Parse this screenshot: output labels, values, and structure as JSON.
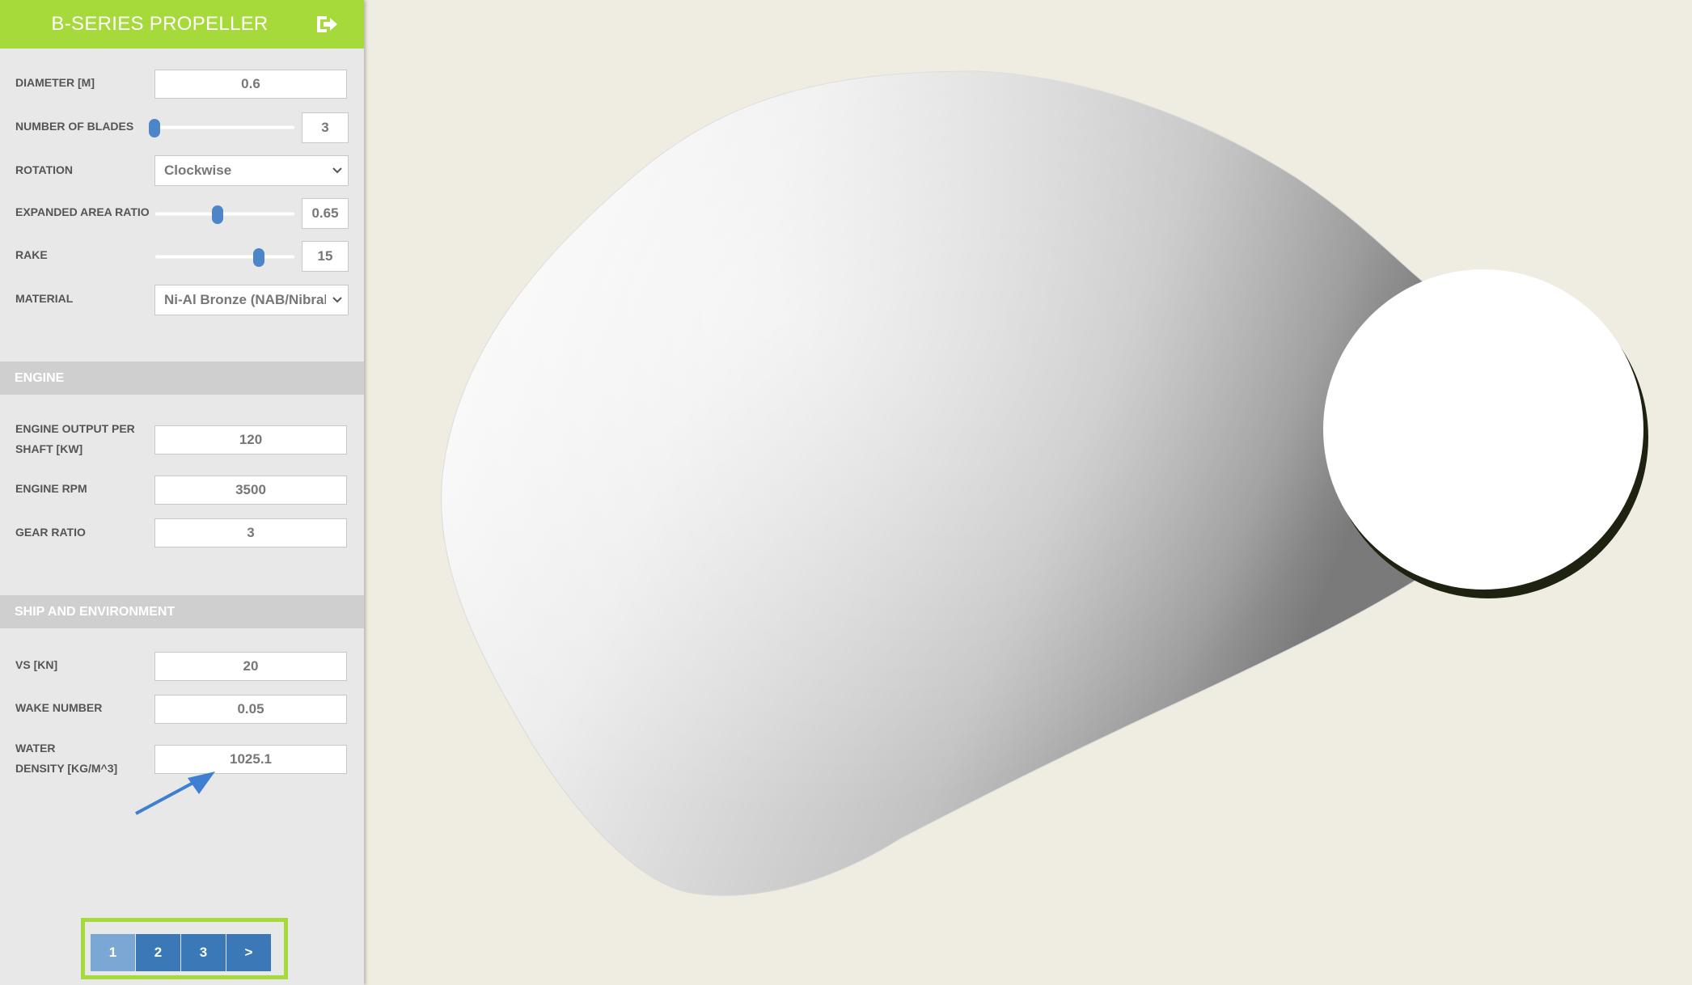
{
  "sidebar": {
    "title": "B-SERIES PROPELLER",
    "exit_icon": "exit-icon",
    "propeller": {
      "diameter": {
        "label": "DIAMETER [m]",
        "value": "0.6"
      },
      "blades": {
        "label": "NUMBER OF BLADES",
        "value": "3",
        "slider_fraction": 0.0
      },
      "rotation": {
        "label": "ROTATION",
        "value": "Clockwise"
      },
      "area_ratio": {
        "label": "EXPANDED AREA RATIO",
        "value": "0.65",
        "slider_fraction": 0.45
      },
      "rake": {
        "label": "RAKE",
        "value": "15",
        "slider_fraction": 0.74
      },
      "material": {
        "label": "MATERIAL",
        "value": "Ni-Al Bronze (NAB/Nibral/"
      }
    },
    "engine": {
      "heading": "ENGINE",
      "output_label_1": "ENGINE OUTPUT PER",
      "output_label_2": "SHAFT [kW]",
      "output_value": "120",
      "rpm_label": "ENGINE RPM",
      "rpm_value": "3500",
      "gear_label": "GEAR RATIO",
      "gear_value": "3"
    },
    "ship": {
      "heading": "SHIP AND ENVIRONMENT",
      "vs_label": "VS [kn]",
      "vs_value": "20",
      "wake_label": "WAKE NUMBER",
      "wake_value": "0.05",
      "density_label_1": "WATER",
      "density_label_2": "DENSITY [kg/m^3]",
      "density_value": "1025.1"
    },
    "pagination": [
      "1",
      "2",
      "3",
      ">"
    ],
    "active_page": "1"
  },
  "colors": {
    "header": "#a6d93a",
    "accent_blue": "#3a78b8",
    "background": "#efede1"
  }
}
